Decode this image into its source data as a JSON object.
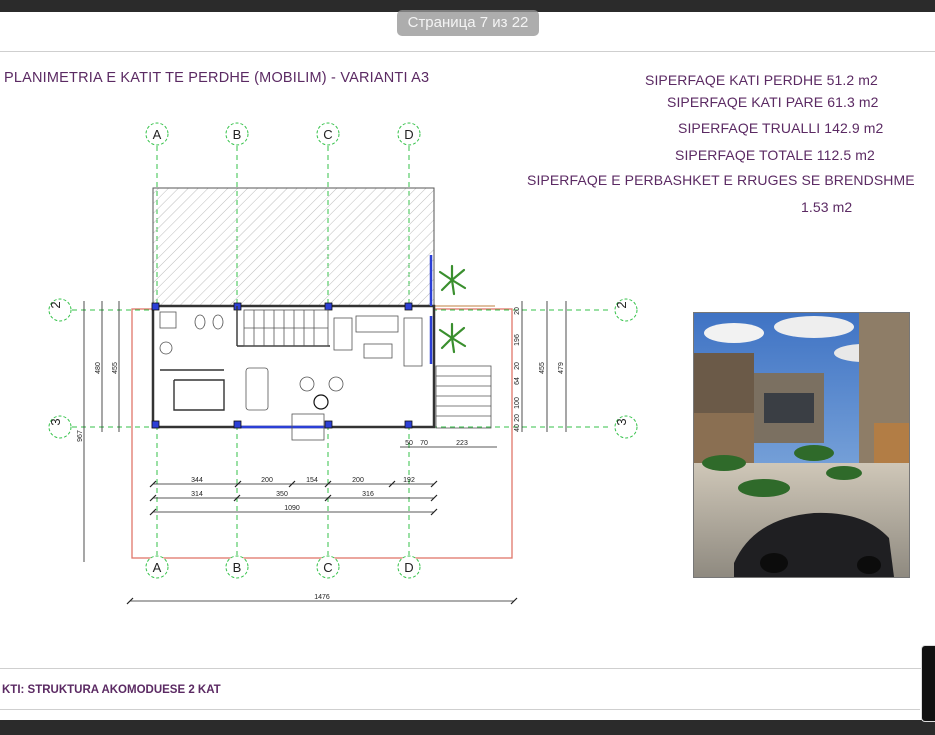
{
  "viewer": {
    "page_indicator": "Страница 7 из 22"
  },
  "sheet": {
    "title": "PLANIMETRIA E KATIT TE PERDHE (MOBILIM) - VARIANTI A3",
    "areas": {
      "kati_perdhe": "SIPERFAQE KATI PERDHE  51.2 m2",
      "kati_pare": "SIPERFAQE KATI PARE  61.3 m2",
      "trualli": "SIPERFAQE TRUALLI  142.9 m2",
      "totale": "SIPERFAQE TOTALE  112.5 m2",
      "perbashket": "SIPERFAQE E PERBASHKET E RRUGES SE BRENDSHME",
      "perbashket_value": "1.53 m2"
    },
    "footer": "KTI: STRUKTURA AKOMODUESE 2 KAT"
  },
  "plan": {
    "grid_top": [
      "A",
      "B",
      "C",
      "D"
    ],
    "grid_bottom": [
      "A",
      "B",
      "C",
      "D"
    ],
    "grid_left": [
      "2",
      "3"
    ],
    "grid_right": [
      "2",
      "3"
    ],
    "dims_row1": [
      "344",
      "200",
      "154",
      "200",
      "192"
    ],
    "dims_row2": [
      "314",
      "350",
      "316"
    ],
    "dims_total": "1090",
    "dims_overall": "1476",
    "dims_right_segments": [
      "50",
      "70",
      "223"
    ],
    "dims_left": [
      "967",
      "480",
      "455"
    ],
    "dims_right_vertical": [
      "20",
      "196",
      "20",
      "64",
      "100",
      "20",
      "40",
      "455",
      "479"
    ]
  },
  "colors": {
    "accent_text": "#5b2a63",
    "grid_line": "#35c24a",
    "site_boundary": "#e0766a",
    "glazing": "#2b3fd6"
  }
}
